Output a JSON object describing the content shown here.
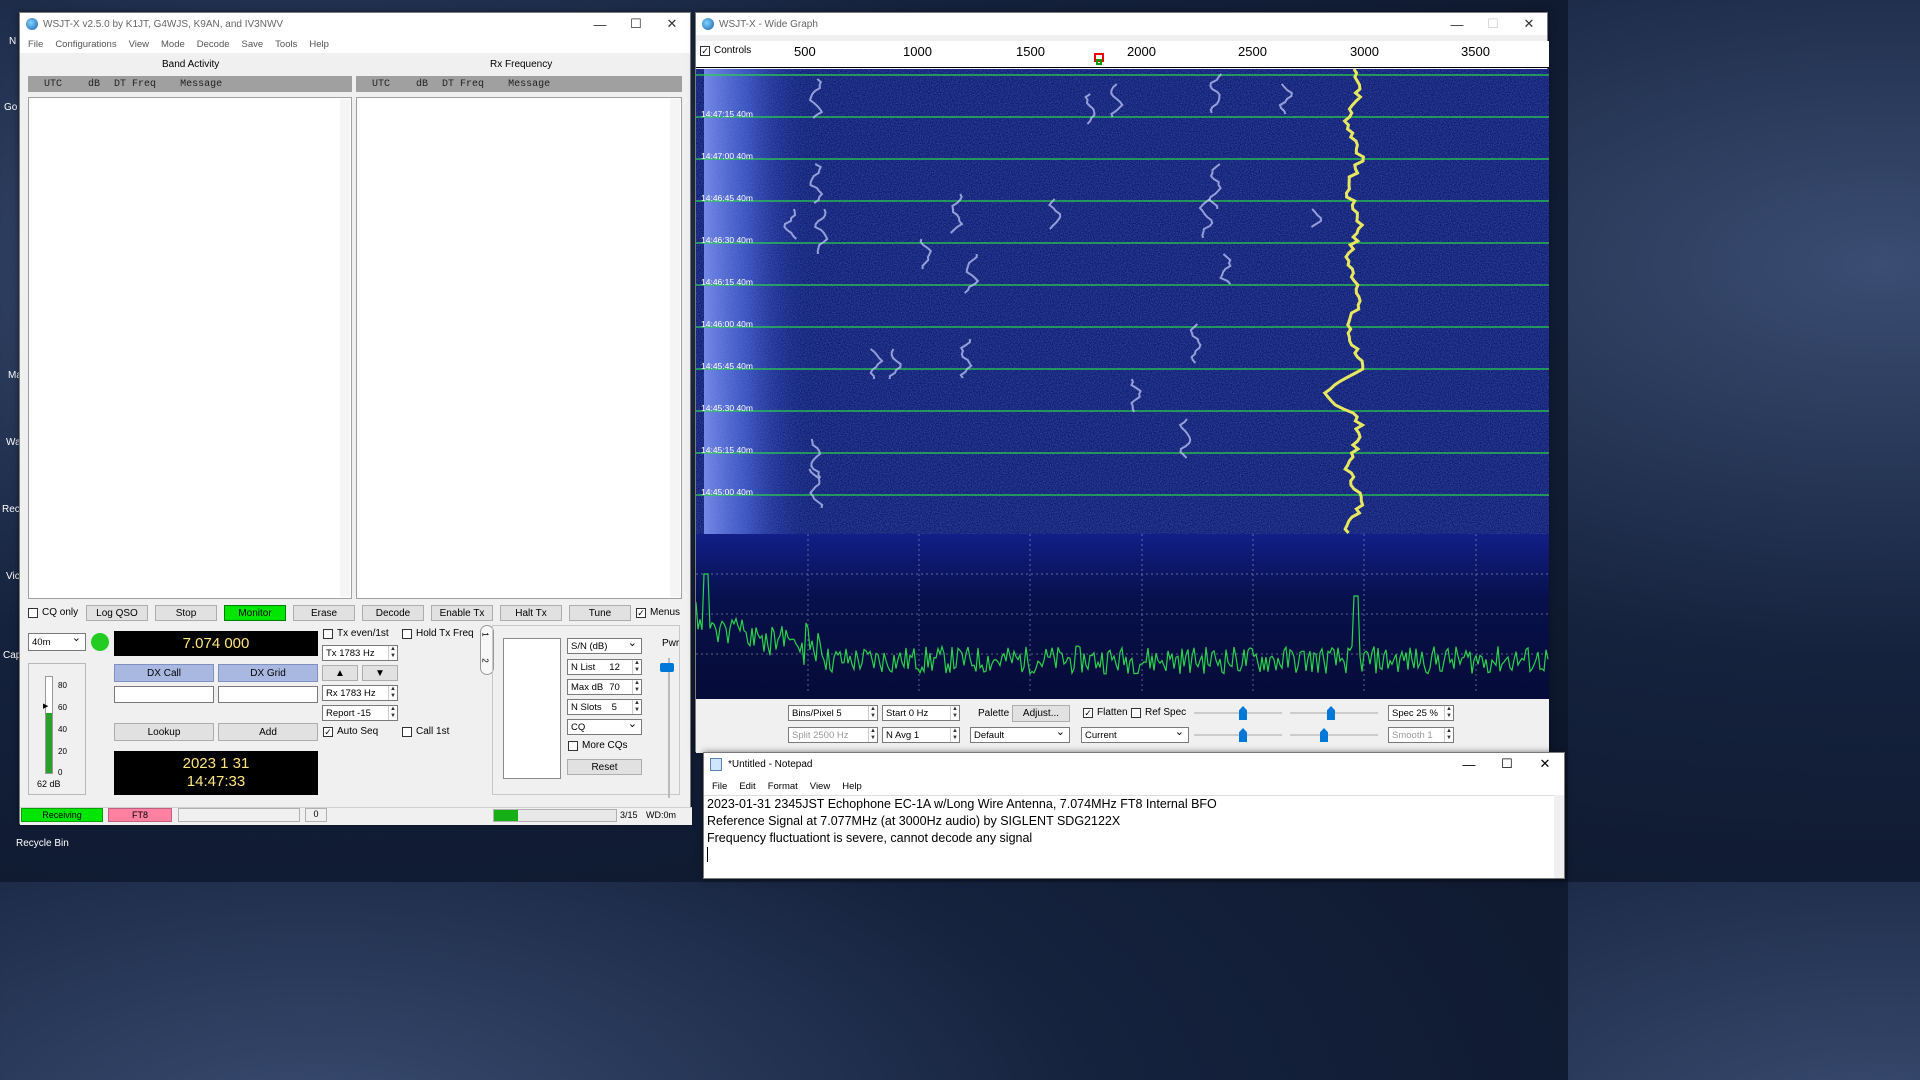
{
  "desktop": {
    "labels": [
      "N",
      "Go",
      "Ma",
      "Wa",
      "Rec",
      "Vic",
      "Cap"
    ],
    "recycle_bin": "Recycle Bin"
  },
  "main": {
    "title": "WSJT-X   v2.5.0   by K1JT, G4WJS, K9AN, and IV3NWV",
    "menu": [
      "File",
      "Configurations",
      "View",
      "Mode",
      "Decode",
      "Save",
      "Tools",
      "Help"
    ],
    "band_activity": "Band Activity",
    "rx_frequency": "Rx Frequency",
    "columns": [
      "UTC",
      "dB",
      "DT",
      "Freq",
      "Message"
    ],
    "buttons": {
      "cq_only": "CQ only",
      "log_qso": "Log QSO",
      "stop": "Stop",
      "monitor": "Monitor",
      "erase": "Erase",
      "decode": "Decode",
      "enable_tx": "Enable Tx",
      "halt_tx": "Halt Tx",
      "tune": "Tune",
      "menus": "Menus"
    },
    "band": "40m",
    "frequency": "7.074 000",
    "tx_even": "Tx even/1st",
    "hold_tx": "Hold Tx Freq",
    "tx_freq": "Tx  1783  Hz",
    "rx_freq": "Rx  1783  Hz",
    "report": "Report -15",
    "auto_seq": "Auto Seq",
    "call_1st": "Call 1st",
    "dx_call": "DX Call",
    "dx_grid": "DX Grid",
    "lookup": "Lookup",
    "add": "Add",
    "date": "2023  1  31",
    "time": "14:47:33",
    "meter_ticks": [
      "80",
      "60",
      "40",
      "20",
      "0"
    ],
    "meter_db": "62 dB",
    "meter_level": 0.62,
    "tab1": "1",
    "tab2": "2",
    "snr": "S/N (dB)",
    "nlist": "N List",
    "nlist_val": "12",
    "maxdb": "Max dB",
    "maxdb_val": "70",
    "nslots": "N Slots",
    "nslots_val": "5",
    "cq": "CQ",
    "more_cqs": "More CQs",
    "reset": "Reset",
    "pwr": "Pwr",
    "status": {
      "receiving": "Receiving",
      "mode": "FT8",
      "count": "0",
      "slot": "3/15",
      "wd": "WD:0m",
      "progress": 0.2
    }
  },
  "wide": {
    "title": "WSJT-X - Wide Graph",
    "controls": "Controls",
    "scale": [
      "500",
      "1000",
      "1500",
      "2000",
      "2500",
      "3000",
      "3500"
    ],
    "timestamps": [
      "14:47:15 40m",
      "14:47:00 40m",
      "14:46:45 40m",
      "14:46:30 40m",
      "14:46:15 40m",
      "14:46:00 40m",
      "14:45:45 40m",
      "14:45:30 40m",
      "14:45:15 40m",
      "14:45:00 40m"
    ],
    "bins": "Bins/Pixel  5",
    "start": "Start 0 Hz",
    "palette": "Palette",
    "adjust": "Adjust...",
    "flatten": "Flatten",
    "ref_spec": "Ref Spec",
    "spec": "Spec 25 %",
    "split": "Split   2500  Hz",
    "navg": "N Avg  1",
    "palette_sel": "Default",
    "current": "Current",
    "smooth": "Smooth    1",
    "colors": {
      "bg": "#0a1a7a",
      "signal": "#e8e860",
      "line": "#2bd34a"
    }
  },
  "notepad": {
    "title": "*Untitled - Notepad",
    "menu": [
      "File",
      "Edit",
      "Format",
      "View",
      "Help"
    ],
    "lines": [
      "2023-01-31 2345JST Echophone EC-1A w/Long Wire Antenna, 7.074MHz FT8 Internal BFO",
      "Reference Signal at 7.077MHz (at 3000Hz audio) by SIGLENT SDG2122X",
      "Frequency fluctuationt is severe, cannot decode any signal"
    ]
  }
}
